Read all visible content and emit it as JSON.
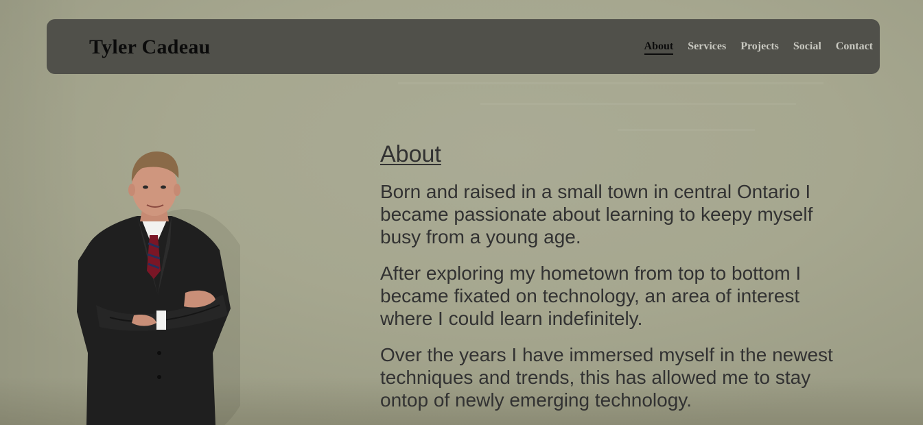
{
  "header": {
    "brand": "Tyler Cadeau",
    "nav": [
      {
        "label": "About",
        "active": true
      },
      {
        "label": "Services",
        "active": false
      },
      {
        "label": "Projects",
        "active": false
      },
      {
        "label": "Social",
        "active": false
      },
      {
        "label": "Contact",
        "active": false
      }
    ]
  },
  "main": {
    "portrait_icon": "person-portrait",
    "heading": "About",
    "paragraphs": [
      "Born and raised in a small town in central Ontario I became passionate about learning to keepy myself busy from a young age.",
      "After exploring my hometown from top to bottom I became fixated on technology, an area of interest where I could learn indefinitely.",
      "Over the years I have immersed myself in the newest techniques and trends, this has allowed me to stay ontop of newly emerging technology."
    ]
  },
  "colors": {
    "background": "#a6a78f",
    "navbar": "#50504a",
    "nav_link": "#c8c8c0",
    "nav_active": "#0b0b0b",
    "text": "#323232"
  }
}
